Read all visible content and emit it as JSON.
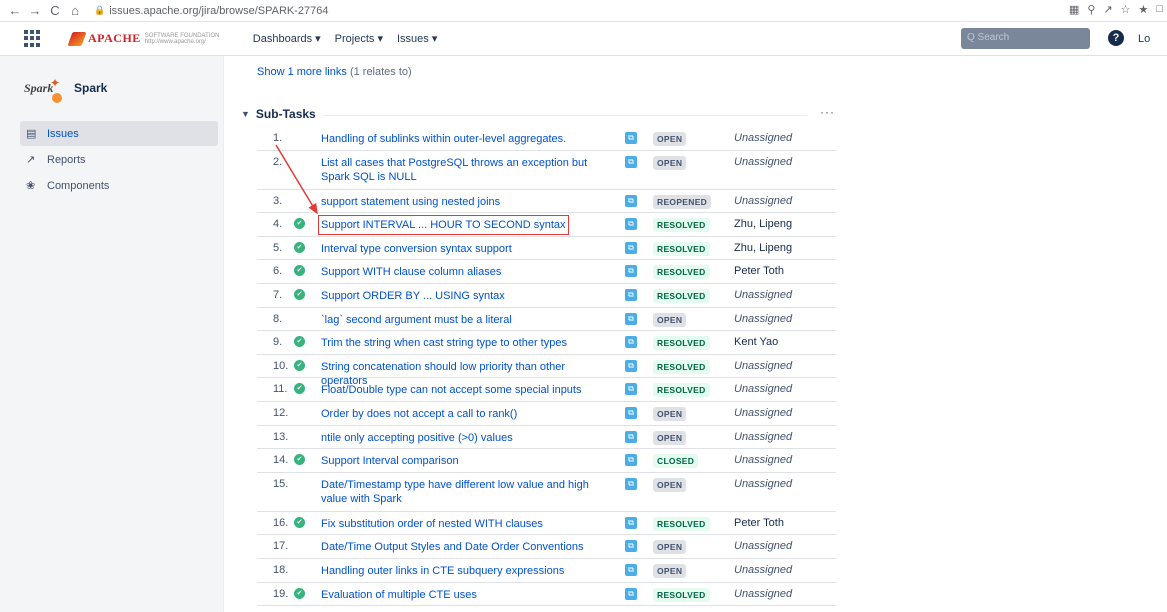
{
  "browser": {
    "url": "issues.apache.org/jira/browse/SPARK-27764",
    "back_icon": "←",
    "forward_icon": "→",
    "reload_icon": "C",
    "home_icon": "⌂"
  },
  "header": {
    "brand": "APACHE",
    "brand_sub": "SOFTWARE FOUNDATION http://www.apache.org/",
    "nav": [
      "Dashboards ▾",
      "Projects ▾",
      "Issues ▾"
    ],
    "search_placeholder": "Q  Search",
    "login": "Lo"
  },
  "sidebar": {
    "project_name": "Spark",
    "logo_word": "Spark",
    "items": [
      {
        "label": "Issues",
        "icon": "issues-icon"
      },
      {
        "label": "Reports",
        "icon": "reports-icon"
      },
      {
        "label": "Components",
        "icon": "components-icon"
      }
    ]
  },
  "main": {
    "show_links": "Show 1 more links",
    "relates": "(1 relates to)",
    "subtasks_title": "Sub-Tasks",
    "more_label": "···",
    "rows": [
      {
        "num": "1.",
        "resolved": false,
        "summary": "Handling of sublinks within outer-level aggregates.",
        "status": "OPEN",
        "assignee": "Unassigned"
      },
      {
        "num": "2.",
        "resolved": false,
        "summary": "List all cases that PostgreSQL throws an exception but Spark SQL is NULL",
        "status": "OPEN",
        "assignee": "Unassigned"
      },
      {
        "num": "3.",
        "resolved": false,
        "summary": "support statement using nested joins",
        "status": "REOPENED",
        "assignee": "Unassigned"
      },
      {
        "num": "4.",
        "resolved": true,
        "summary": "Support INTERVAL ... HOUR TO SECOND syntax",
        "status": "RESOLVED",
        "assignee": "Zhu, Lipeng"
      },
      {
        "num": "5.",
        "resolved": true,
        "summary": "Interval type conversion syntax support",
        "status": "RESOLVED",
        "assignee": "Zhu, Lipeng"
      },
      {
        "num": "6.",
        "resolved": true,
        "summary": "Support WITH clause column aliases",
        "status": "RESOLVED",
        "assignee": "Peter Toth"
      },
      {
        "num": "7.",
        "resolved": true,
        "summary": "Support ORDER BY ... USING syntax",
        "status": "RESOLVED",
        "assignee": "Unassigned"
      },
      {
        "num": "8.",
        "resolved": false,
        "summary": "`lag` second argument must be a literal",
        "status": "OPEN",
        "assignee": "Unassigned"
      },
      {
        "num": "9.",
        "resolved": true,
        "summary": "Trim the string when cast string type to other types",
        "status": "RESOLVED",
        "assignee": "Kent Yao"
      },
      {
        "num": "10.",
        "resolved": true,
        "summary": "String concatenation should low priority than other operators",
        "status": "RESOLVED",
        "assignee": "Unassigned"
      },
      {
        "num": "11.",
        "resolved": true,
        "summary": "Float/Double type can not accept some special inputs",
        "status": "RESOLVED",
        "assignee": "Unassigned"
      },
      {
        "num": "12.",
        "resolved": false,
        "summary": "Order by does not accept a call to rank()",
        "status": "OPEN",
        "assignee": "Unassigned"
      },
      {
        "num": "13.",
        "resolved": false,
        "summary": "ntile only accepting positive (>0) values",
        "status": "OPEN",
        "assignee": "Unassigned"
      },
      {
        "num": "14.",
        "resolved": true,
        "summary": "Support Interval comparison",
        "status": "CLOSED",
        "assignee": "Unassigned"
      },
      {
        "num": "15.",
        "resolved": false,
        "summary": "Date/Timestamp type have different low value and high value with Spark",
        "status": "OPEN",
        "assignee": "Unassigned"
      },
      {
        "num": "16.",
        "resolved": true,
        "summary": "Fix substitution order of nested WITH clauses",
        "status": "RESOLVED",
        "assignee": "Peter Toth"
      },
      {
        "num": "17.",
        "resolved": false,
        "summary": "Date/Time Output Styles and Date Order Conventions",
        "status": "OPEN",
        "assignee": "Unassigned"
      },
      {
        "num": "18.",
        "resolved": false,
        "summary": "Handling outer links in CTE subquery expressions",
        "status": "OPEN",
        "assignee": "Unassigned"
      },
      {
        "num": "19.",
        "resolved": true,
        "summary": "Evaluation of multiple CTE uses",
        "status": "RESOLVED",
        "assignee": "Unassigned"
      }
    ]
  }
}
